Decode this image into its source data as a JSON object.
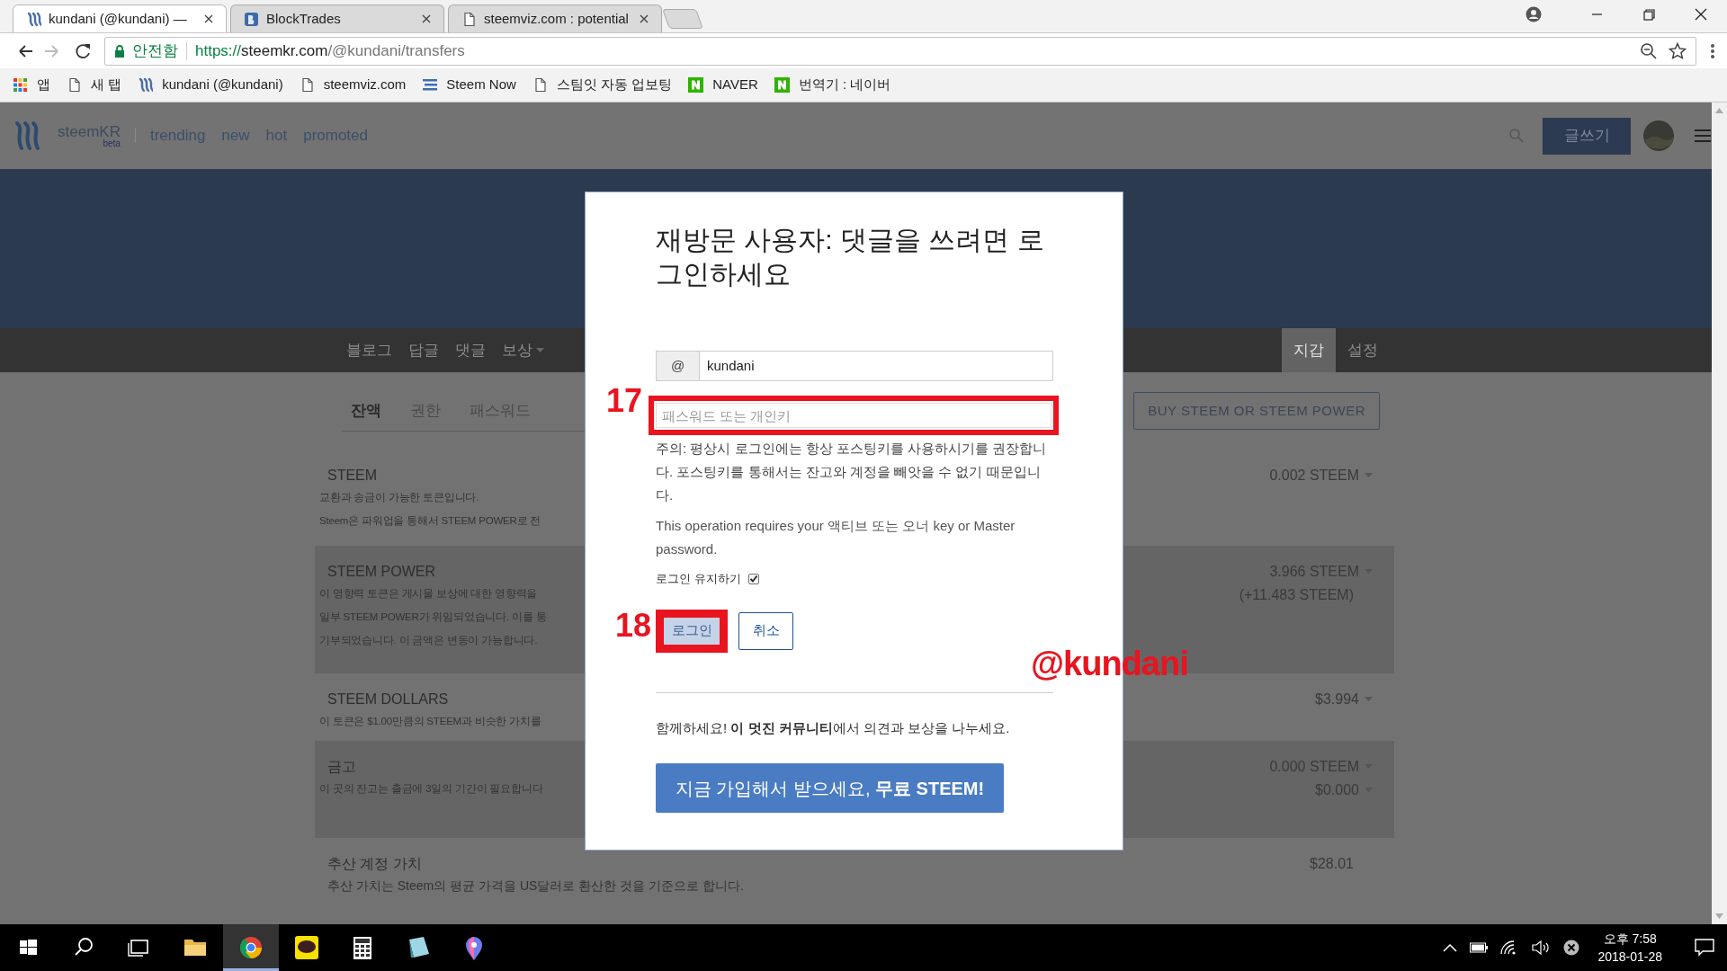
{
  "browser": {
    "tabs": [
      {
        "title": "kundani (@kundani) —",
        "kind": "steem",
        "selected": true
      },
      {
        "title": "BlockTrades",
        "kind": "blocktrades",
        "selected": false
      },
      {
        "title": "steemviz.com : potential",
        "kind": "page",
        "selected": false
      }
    ],
    "address": {
      "secure_label": "안전함",
      "scheme": "https://",
      "host": "steemkr.com",
      "path": "/@kundani/transfers"
    },
    "bookmarks": [
      {
        "label": "앱",
        "kind": "apps"
      },
      {
        "label": "새 탭",
        "kind": "page"
      },
      {
        "label": "kundani (@kundani)",
        "kind": "steem"
      },
      {
        "label": "steemviz.com",
        "kind": "page"
      },
      {
        "label": "Steem Now",
        "kind": "lines"
      },
      {
        "label": "스팀잇 자동 업보팅",
        "kind": "page"
      },
      {
        "label": "NAVER",
        "kind": "naver"
      },
      {
        "label": "번역기 : 네이버",
        "kind": "naver"
      }
    ]
  },
  "site": {
    "brand": "steemKR",
    "brand_sub": "beta",
    "nav": [
      "trending",
      "new",
      "hot",
      "promoted"
    ],
    "write_button": "글쓰기"
  },
  "profile_tabs": [
    {
      "label": "블로그",
      "dropdown": false,
      "selected": false
    },
    {
      "label": "답글",
      "dropdown": false,
      "selected": false
    },
    {
      "label": "댓글",
      "dropdown": false,
      "selected": false
    },
    {
      "label": "보상",
      "dropdown": true,
      "selected": false
    }
  ],
  "profile_tabs_right": [
    {
      "label": "지갑",
      "selected": true
    },
    {
      "label": "설정",
      "selected": false
    }
  ],
  "wallet_tabs": [
    {
      "label": "잔액",
      "selected": true
    },
    {
      "label": "권한",
      "selected": false
    },
    {
      "label": "패스워드",
      "selected": false
    }
  ],
  "buy_button": "BUY STEEM OR STEEM POWER",
  "rows": [
    {
      "title": "STEEM",
      "shaded": false,
      "description": [
        "교환과 송금이 가능한 토큰입니다.",
        "Steem은 파워업을 통해서 STEEM POWER로 전"
      ],
      "values": [
        {
          "text": "0.002 STEEM",
          "dropdown": true
        }
      ]
    },
    {
      "title": "STEEM POWER",
      "shaded": true,
      "description": [
        "이 영향력 토큰은 게시물 보상에 대한 영향력을",
        "일부 STEEM POWER가 위임되었습니다. 이를 통",
        "기부되었습니다. 이 금액은 변동이 가능합니다."
      ],
      "values": [
        {
          "text": "3.966 STEEM",
          "dropdown": true
        },
        {
          "text": "(+11.483 STEEM)",
          "dropdown": false
        }
      ]
    },
    {
      "title": "STEEM DOLLARS",
      "shaded": false,
      "description": [
        "이 토큰은 $1.00만큼의 STEEM과 비슷한 가치를"
      ],
      "values": [
        {
          "text": "$3.994",
          "dropdown": true
        }
      ]
    },
    {
      "title": "금고",
      "shaded": true,
      "description": [
        "이 곳의 잔고는 출금에 3일의 기간이 필요합니다"
      ],
      "values": [
        {
          "text": "0.000 STEEM",
          "dropdown": true
        },
        {
          "text": "$0.000",
          "dropdown": true
        }
      ]
    },
    {
      "title": "추산 계정 가치",
      "shaded": false,
      "description": [
        "추산 가치는 Steem의 평균 가격을 US달러로 환산한 것을 기준으로 합니다."
      ],
      "values": [
        {
          "text": "$28.01",
          "dropdown": false
        }
      ]
    }
  ],
  "modal": {
    "title": "재방문 사용자: 댓글을 쓰려면 로그인하세요",
    "username_prefix": "@",
    "username": "kundani",
    "password_placeholder": "패스워드 또는 개인키",
    "warning": "주의: 평상시 로그인에는 항상 포스팅키를 사용하시기를 권장합니다. 포스팅키를 통해서는 잔고와 계정을 빼앗을 수 없기 때문입니다.",
    "note": "This operation requires your 액티브 또는 오너 key or Master password.",
    "keep_logged_in": {
      "label": "로그인 유지하기",
      "checked": true
    },
    "login_button": {
      "label": "로그인",
      "disabled": true
    },
    "cancel_button": "취소",
    "join_text": "함께하세요! **이 멋진 커뮤니티**에서 의견과 보상을 나누세요.",
    "signup_button": "지금 가입해서 받으세요, **무료 STEEM!**"
  },
  "annotations": [
    {
      "label": "17"
    },
    {
      "label": "18"
    }
  ],
  "signature": "@kundani",
  "taskbar": {
    "apps": [
      {
        "kind": "search",
        "active": false
      },
      {
        "kind": "taskview",
        "active": false
      },
      {
        "kind": "folder",
        "active": false
      },
      {
        "kind": "chrome",
        "active": true
      },
      {
        "kind": "talk",
        "active": false
      },
      {
        "kind": "calculator",
        "active": false
      },
      {
        "kind": "slate",
        "active": false
      },
      {
        "kind": "pin",
        "active": false
      }
    ],
    "time": "오후 7:58",
    "date": "2018-01-28"
  }
}
